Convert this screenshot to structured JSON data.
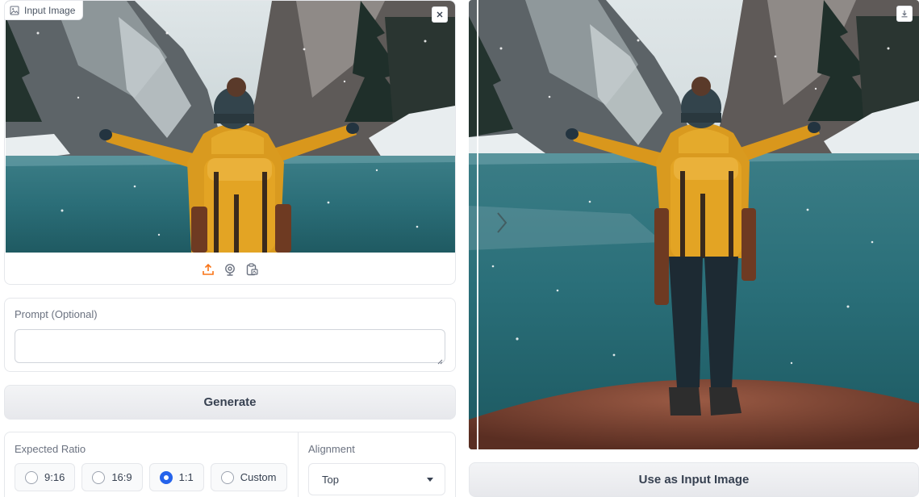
{
  "input_panel": {
    "label": "Input Image",
    "label_icon": "image-icon",
    "clear_icon": "close-icon",
    "sources": [
      {
        "icon": "upload-icon",
        "color": "#f97316"
      },
      {
        "icon": "webcam-icon",
        "color": "#6b7280"
      },
      {
        "icon": "clipboard-icon",
        "color": "#6b7280"
      }
    ]
  },
  "prompt": {
    "label": "Prompt (Optional)",
    "value": "",
    "placeholder": ""
  },
  "generate_button": "Generate",
  "ratio": {
    "label": "Expected Ratio",
    "options": [
      "9:16",
      "16:9",
      "1:1",
      "Custom"
    ],
    "selected": "1:1"
  },
  "alignment": {
    "label": "Alignment",
    "value": "Top"
  },
  "output_panel": {
    "download_icon": "download-icon",
    "slider_icon": "chevron-right-icon"
  },
  "use_as_input_button": "Use as Input Image",
  "colors": {
    "accent": "#2563eb",
    "upload_accent": "#f97316",
    "jacket": "#e0a11f",
    "water": "#2f7b86"
  }
}
